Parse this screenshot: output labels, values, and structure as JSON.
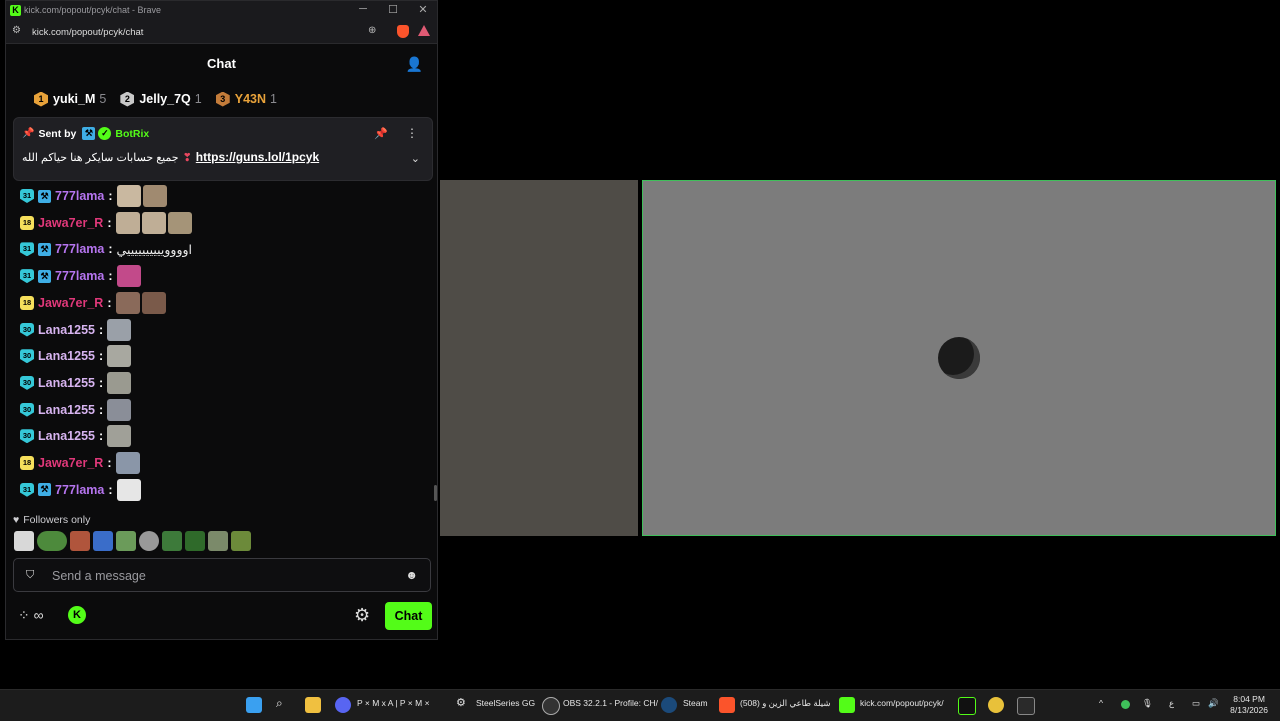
{
  "browser": {
    "window_title": "kick.com/popout/pcyk/chat - Brave",
    "url": "kick.com/popout/pcyk/chat"
  },
  "chat": {
    "title": "Chat",
    "leaderboard": [
      {
        "rank": "1",
        "name": "yuki_M",
        "count": "5",
        "color": "#e8a23a"
      },
      {
        "rank": "2",
        "name": "Jelly_7Q",
        "count": "1",
        "color": "#c9c9c9"
      },
      {
        "rank": "3",
        "name": "Y43N",
        "count": "1",
        "color": "#c47c3a"
      }
    ],
    "pinned": {
      "sent_by": "Sent by",
      "bot_name": "BotRix",
      "text": "جميع حسابات سايكر هنا حياكم الله",
      "link": "https://guns.lol/1pcyk"
    },
    "messages": [
      {
        "sub": "31",
        "user": "777lama",
        "color": "#b675f0",
        "text": ""
      },
      {
        "sub": "18",
        "user": "Jawa7er_R",
        "color": "#e0387a",
        "text": ""
      },
      {
        "sub": "31",
        "user": "777lama",
        "color": "#b675f0",
        "text": "اووووييييييييييي"
      },
      {
        "sub": "31",
        "user": "777lama",
        "color": "#b675f0",
        "text": ""
      },
      {
        "sub": "18",
        "user": "Jawa7er_R",
        "color": "#e0387a",
        "text": ""
      },
      {
        "sub": "30",
        "user": "Lana1255",
        "color": "#d7b4f0",
        "text": ""
      },
      {
        "sub": "30",
        "user": "Lana1255",
        "color": "#d7b4f0",
        "text": ""
      },
      {
        "sub": "30",
        "user": "Lana1255",
        "color": "#d7b4f0",
        "text": ""
      },
      {
        "sub": "30",
        "user": "Lana1255",
        "color": "#d7b4f0",
        "text": ""
      },
      {
        "sub": "30",
        "user": "Lana1255",
        "color": "#d7b4f0",
        "text": ""
      },
      {
        "sub": "18",
        "user": "Jawa7er_R",
        "color": "#e0387a",
        "text": ""
      },
      {
        "sub": "31",
        "user": "777lama",
        "color": "#b675f0",
        "text": ""
      }
    ],
    "followers_only": "Followers only",
    "input_placeholder": "Send a message",
    "chat_button": "Chat",
    "accent": "#53fc18"
  },
  "taskbar": {
    "items": [
      {
        "label": "P × M x A | P × M ×"
      },
      {
        "label": "SteelSeries GG"
      },
      {
        "label": "OBS 32.2.1 - Profile: CH/"
      },
      {
        "label": "Steam"
      },
      {
        "label": "(508) شيلة طاعي الزين و"
      },
      {
        "label": "kick.com/popout/pcyk/"
      }
    ],
    "lang": "ع",
    "time": "8:04 PM",
    "date": "8/13/2026"
  }
}
